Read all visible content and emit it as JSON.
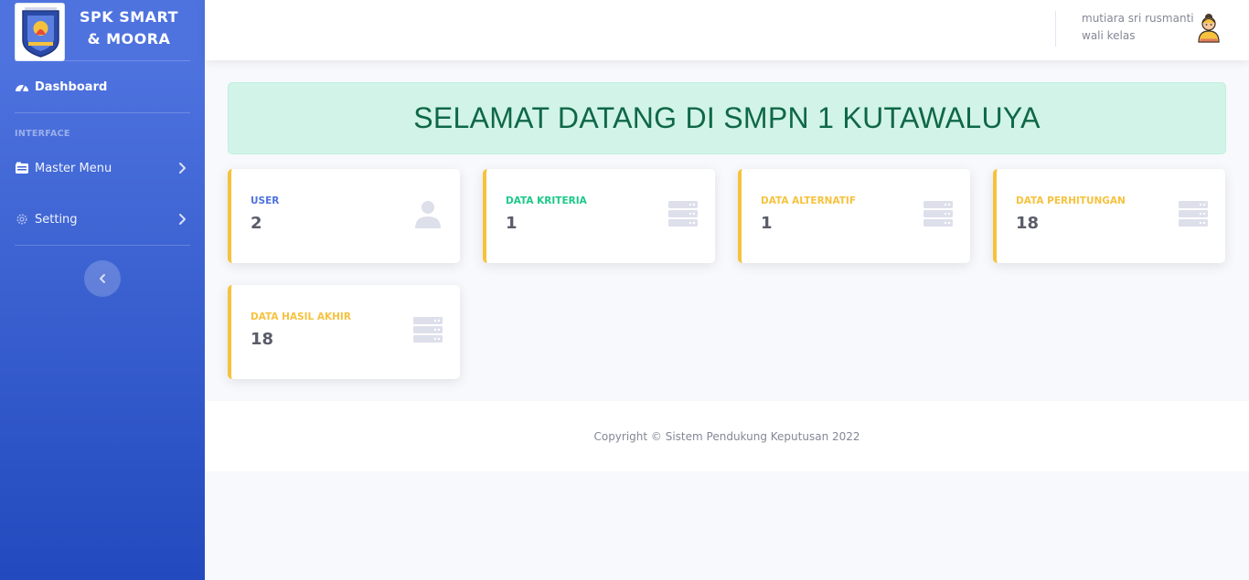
{
  "brand": {
    "line1": "SPK SMART",
    "line2": "& MOORA",
    "logo_icon": "school-crest-logo"
  },
  "sidebar": {
    "dashboard_label": "Dashboard",
    "heading": "INTERFACE",
    "items": [
      {
        "label": "Master Menu",
        "icon": "folder-icon"
      },
      {
        "label": "Setting",
        "icon": "gear-icon"
      }
    ],
    "toggle_icon": "chevron-left-icon"
  },
  "topbar": {
    "user_name": "mutiara sri rusmanti",
    "user_role": "wali kelas",
    "avatar_icon": "user-avatar-icon"
  },
  "welcome": {
    "text": "SELAMAT DATANG DI SMPN 1 KUTAWALUYA"
  },
  "cards": [
    {
      "label": "USER",
      "value": "2",
      "icon": "user-icon"
    },
    {
      "label": "DATA KRITERIA",
      "value": "1",
      "icon": "server-icon"
    },
    {
      "label": "DATA ALTERNATIF",
      "value": "1",
      "icon": "server-icon"
    },
    {
      "label": "DATA PERHITUNGAN",
      "value": "18",
      "icon": "server-icon"
    },
    {
      "label": "DATA HASIL AKHIR",
      "value": "18",
      "icon": "server-icon"
    }
  ],
  "footer": {
    "copyright": "Copyright © Sistem Pendukung Keputusan 2022"
  },
  "colors": {
    "primary": "#4e73df",
    "success": "#1cc88a",
    "warning": "#f6c23e",
    "welcome_bg": "#d2f4e8",
    "welcome_text": "#0f6848"
  }
}
